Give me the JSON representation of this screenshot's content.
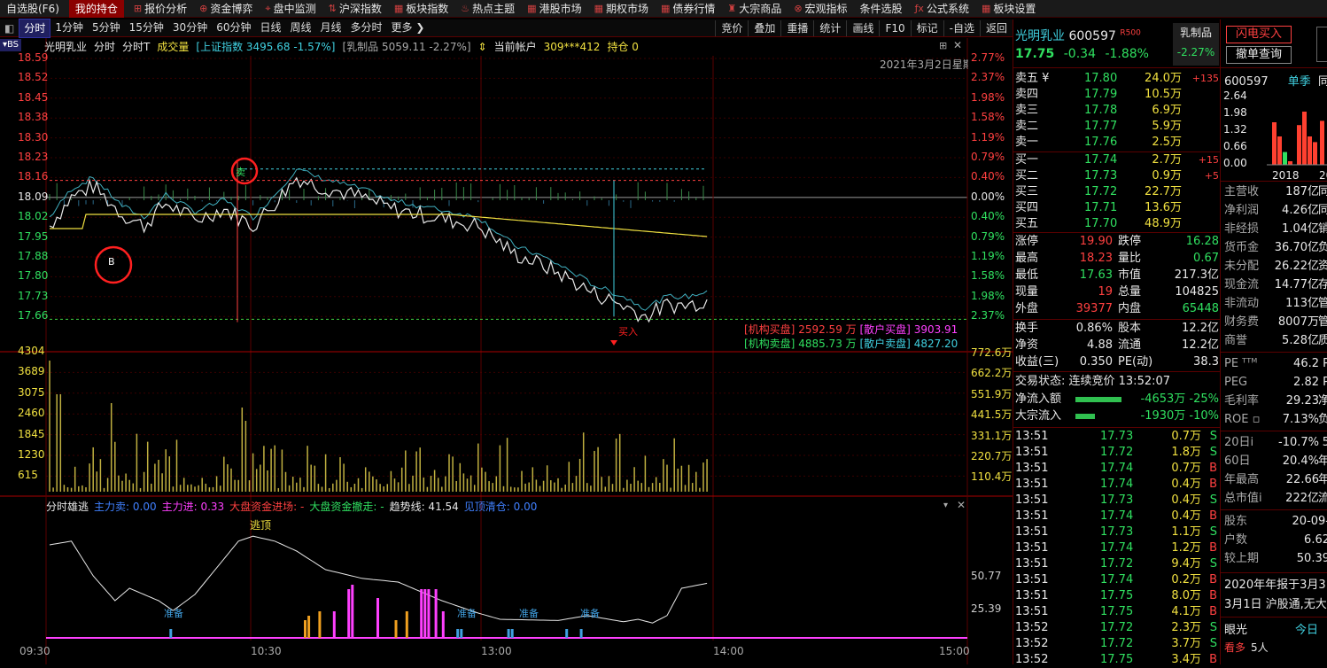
{
  "topbar": {
    "items": [
      {
        "label": "自选股(F6)"
      },
      {
        "label": "我的持仓"
      },
      {
        "label": "报价分析"
      },
      {
        "label": "资金博弈"
      },
      {
        "label": "盘中监测"
      },
      {
        "label": "沪深指数"
      },
      {
        "label": "板块指数"
      },
      {
        "label": "热点主题"
      },
      {
        "label": "港股市场"
      },
      {
        "label": "期权市场"
      },
      {
        "label": "债券行情"
      },
      {
        "label": "大宗商品"
      },
      {
        "label": "宏观指标"
      },
      {
        "label": "条件选股"
      },
      {
        "label": "公式系统"
      },
      {
        "label": "板块设置"
      }
    ]
  },
  "subbar": {
    "periods": [
      "分时",
      "1分钟",
      "5分钟",
      "15分钟",
      "30分钟",
      "60分钟",
      "日线",
      "周线",
      "月线",
      "多分时",
      "更多 ❯"
    ],
    "right_buttons": [
      "竞价",
      "叠加",
      "重播",
      "统计",
      "画线",
      "F10",
      "标记",
      "-自选",
      "返回"
    ],
    "bs_label": "▾BS"
  },
  "info": {
    "name": "光明乳业",
    "mode": "分时",
    "mode2": "分时T",
    "vol_label": "成交量",
    "index": "[上证指数 3495.68 -1.57%]",
    "sector": "[乳制品 5059.11 -2.27%]",
    "account_label": "当前帐户",
    "account": "309***412",
    "hold": "持仓 0",
    "date": "2021年3月2日星期"
  },
  "price_axis": {
    "left": [
      "18.59",
      "18.52",
      "18.45",
      "18.38",
      "18.30",
      "18.23",
      "18.16",
      "18.09",
      "18.02",
      "17.95",
      "17.88",
      "17.80",
      "17.73",
      "17.66"
    ],
    "right": [
      "2.77%",
      "2.37%",
      "1.98%",
      "1.58%",
      "1.19%",
      "0.79%",
      "0.40%",
      "0.00%",
      "0.40%",
      "0.79%",
      "1.19%",
      "1.58%",
      "1.98%",
      "2.37%"
    ]
  },
  "vol_axis": {
    "left": [
      "4304",
      "3689",
      "3075",
      "2460",
      "1845",
      "1230",
      "615"
    ],
    "right": [
      "772.6万",
      "662.2万",
      "551.9万",
      "441.5万",
      "331.1万",
      "220.7万",
      "110.4万"
    ]
  },
  "time_axis": [
    "09:30",
    "10:30",
    "13:00",
    "14:00",
    "15:00"
  ],
  "flow_labels": {
    "inst_buy": "[机构买盘]",
    "inst_buy_val": "2592.59 万",
    "retail_buy": "[散户买盘]",
    "retail_buy_val": "3903.91",
    "inst_sell": "[机构卖盘]",
    "inst_sell_val": "4885.73 万",
    "retail_sell": "[散户卖盘]",
    "retail_sell_val": "4827.20"
  },
  "markers": {
    "buy": "B",
    "sell": "卖",
    "buy_in": "买入"
  },
  "indicator": {
    "title": "分时雄逃",
    "main_sell": "主力卖: 0.00",
    "main_in": "主力进: 0.33",
    "big_in": "大盘资金进场: -",
    "big_out": "大盘资金撤走: -",
    "trend": "趋势线: 41.54",
    "hole": "见顶清仓: 0.00",
    "top_label": "逃顶",
    "ready": "准备",
    "axis": [
      "50.77",
      "25.39"
    ]
  },
  "quote": {
    "name": "光明乳业",
    "code": "600597",
    "tag": "R500",
    "sector": "乳制品",
    "sector_chg": "-2.27%",
    "price": "17.75",
    "chg": "-0.34",
    "pct": "-1.88%",
    "sells": [
      {
        "label": "卖五 ¥",
        "price": "17.80",
        "vol": "24.0万",
        "delta": "+135"
      },
      {
        "label": "卖四",
        "price": "17.79",
        "vol": "10.5万",
        "delta": ""
      },
      {
        "label": "卖三",
        "price": "17.78",
        "vol": "6.9万",
        "delta": ""
      },
      {
        "label": "卖二",
        "price": "17.77",
        "vol": "5.9万",
        "delta": ""
      },
      {
        "label": "卖一",
        "price": "17.76",
        "vol": "2.5万",
        "delta": ""
      }
    ],
    "buys": [
      {
        "label": "买一",
        "price": "17.74",
        "vol": "2.7万",
        "delta": "+15"
      },
      {
        "label": "买二",
        "price": "17.73",
        "vol": "0.9万",
        "delta": "+5"
      },
      {
        "label": "买三",
        "price": "17.72",
        "vol": "22.7万",
        "delta": ""
      },
      {
        "label": "买四",
        "price": "17.71",
        "vol": "13.6万",
        "delta": ""
      },
      {
        "label": "买五",
        "price": "17.70",
        "vol": "48.9万",
        "delta": ""
      }
    ],
    "stats": [
      {
        "l1": "涨停",
        "v1": "19.90",
        "l2": "跌停",
        "v2": "16.28"
      },
      {
        "l1": "最高",
        "v1": "18.23",
        "l2": "量比",
        "v2": "0.67"
      },
      {
        "l1": "最低",
        "v1": "17.63",
        "l2": "市值",
        "v2": "217.3亿"
      },
      {
        "l1": "现量",
        "v1": "19",
        "l2": "总量",
        "v2": "104825"
      },
      {
        "l1": "外盘",
        "v1": "39377",
        "l2": "内盘",
        "v2": "65448"
      }
    ],
    "stats2": [
      {
        "l1": "换手",
        "v1": "0.86%",
        "l2": "股本",
        "v2": "12.2亿"
      },
      {
        "l1": "净资",
        "v1": "4.88",
        "l2": "流通",
        "v2": "12.2亿"
      },
      {
        "l1": "收益(三)",
        "v1": "0.350",
        "l2": "PE(动)",
        "v2": "38.3"
      }
    ],
    "trade_state": "交易状态: 连续竞价 13:52:07",
    "net_in_label": "净流入额",
    "net_in": "-4653万 -25%",
    "big_in_label": "大宗流入",
    "big_in": "-1930万 -10%",
    "ticks": [
      [
        "13:51",
        "17.73",
        "0.7万",
        "S"
      ],
      [
        "13:51",
        "17.72",
        "1.8万",
        "S"
      ],
      [
        "13:51",
        "17.74",
        "0.7万",
        "B"
      ],
      [
        "13:51",
        "17.74",
        "0.4万",
        "B"
      ],
      [
        "13:51",
        "17.73",
        "0.4万",
        "S"
      ],
      [
        "13:51",
        "17.74",
        "0.4万",
        "B"
      ],
      [
        "13:51",
        "17.73",
        "1.1万",
        "S"
      ],
      [
        "13:51",
        "17.74",
        "1.2万",
        "B"
      ],
      [
        "13:51",
        "17.72",
        "9.4万",
        "S"
      ],
      [
        "13:51",
        "17.74",
        "0.2万",
        "B"
      ],
      [
        "13:51",
        "17.75",
        "8.0万",
        "B"
      ],
      [
        "13:51",
        "17.75",
        "4.1万",
        "B"
      ],
      [
        "13:52",
        "17.72",
        "2.3万",
        "S"
      ],
      [
        "13:52",
        "17.72",
        "3.7万",
        "S"
      ],
      [
        "13:52",
        "17.75",
        "3.4万",
        "B"
      ]
    ]
  },
  "far": {
    "btn1": "闪电买入",
    "btn2": "撤单查询",
    "code": "600597",
    "mode": "单季",
    "mode2": "同",
    "chart_axis": [
      "2.64",
      "1.98",
      "1.32",
      "0.66",
      "0.00"
    ],
    "chart_years": [
      "2018",
      "20"
    ],
    "fin": [
      {
        "l": "主营收",
        "v": "187亿",
        "x": "同"
      },
      {
        "l": "净利润",
        "v": "4.26亿",
        "x": "同"
      },
      {
        "l": "非经损",
        "v": "1.04亿",
        "x": "销"
      },
      {
        "l": "货币金",
        "v": "36.70亿",
        "x": "负"
      },
      {
        "l": "未分配",
        "v": "26.22亿",
        "x": "资"
      },
      {
        "l": "现金流",
        "v": "14.77亿",
        "x": "存"
      },
      {
        "l": "非流动",
        "v": "113亿",
        "x": "管"
      },
      {
        "l": "财务费",
        "v": "8007万",
        "x": "管"
      },
      {
        "l": "商誉",
        "v": "5.28亿",
        "x": "质"
      }
    ],
    "ratios": [
      {
        "l": "PE ᵀᵀᴹ",
        "v": "46.2",
        "x": "P"
      },
      {
        "l": "PEG",
        "v": "2.82",
        "x": "P"
      },
      {
        "l": "毛利率",
        "v": "29.23",
        "x": "净"
      },
      {
        "l": "ROE ▫",
        "v": "7.13%",
        "x": "负"
      }
    ],
    "perf": [
      {
        "l": "20日i",
        "v": "-10.7%",
        "x": "5"
      },
      {
        "l": "60日",
        "v": "20.4%",
        "x": "年"
      },
      {
        "l": "年最高",
        "v": "22.66",
        "x": "年"
      },
      {
        "l": "总市值i",
        "v": "222亿",
        "x": "流"
      }
    ],
    "share": [
      {
        "l": "股东",
        "v": "20-09-"
      },
      {
        "l": "户数",
        "v": "6.62"
      },
      {
        "l": "较上期",
        "v": "50.39"
      }
    ],
    "news1": "2020年年报于3月3",
    "news2": "3月1日 沪股通,无大",
    "view": "眼光",
    "today": "今日",
    "bull": "看多",
    "bull_n": "5人"
  },
  "colors": {
    "up": "#ff4040",
    "down": "#30e060",
    "price_line": "#e8e8e8",
    "avg_line": "#f0e040",
    "bg": "#000000",
    "grid": "#5a0000"
  }
}
